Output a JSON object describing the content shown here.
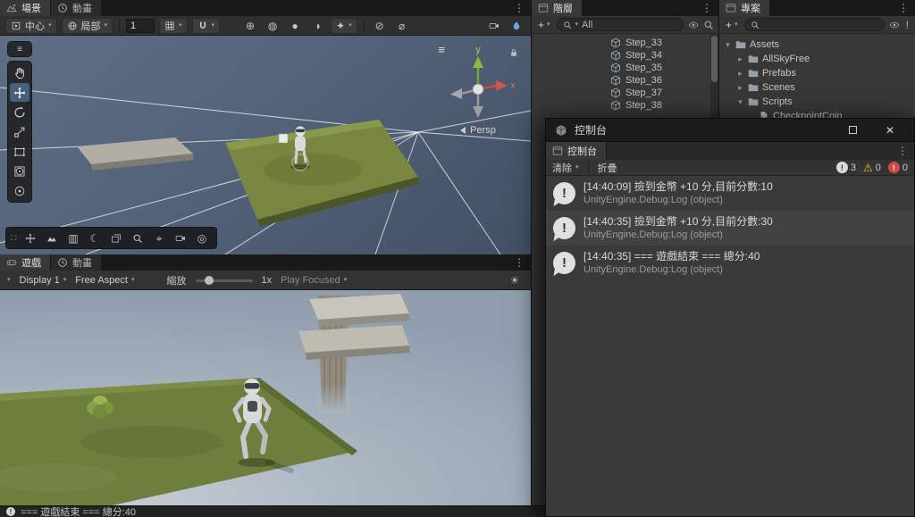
{
  "colors": {
    "accent_blue": "#46607a",
    "warning_yellow": "#f0c32e",
    "error_red": "#d04848",
    "panel_bg": "#383838"
  },
  "top_bar": {
    "tabs": [
      {
        "label": "場景"
      },
      {
        "label": "動畫"
      }
    ]
  },
  "scene_toolbar": {
    "pivot_label": "中心",
    "space_label": "局部",
    "grid_size_value": "1"
  },
  "scene_view": {
    "gizmo_axis_x": "x",
    "gizmo_axis_y": "y",
    "projection_label": "Persp"
  },
  "game_panel": {
    "tabs": [
      {
        "label": "遊戲"
      },
      {
        "label": "動畫"
      }
    ],
    "display_label": "Display 1",
    "aspect_label": "Free Aspect",
    "zoom_label": "縮放",
    "zoom_value": "1x",
    "play_focused_label": "Play Focused"
  },
  "hierarchy": {
    "tab_label": "階層",
    "search_value": "All",
    "items": [
      {
        "label": "Step_33"
      },
      {
        "label": "Step_34"
      },
      {
        "label": "Step_35"
      },
      {
        "label": "Step_36"
      },
      {
        "label": "Step_37"
      },
      {
        "label": "Step_38"
      }
    ]
  },
  "project": {
    "tab_label": "專案",
    "tree": [
      {
        "label": "Assets"
      },
      {
        "label": "AllSkyFree"
      },
      {
        "label": "Prefabs"
      },
      {
        "label": "Scenes"
      },
      {
        "label": "Scripts"
      },
      {
        "label": "CheckpointCoin"
      }
    ]
  },
  "console": {
    "window_title": "控制台",
    "tab_label": "控制台",
    "clear_label": "清除",
    "collapse_label": "折疊",
    "info_count": "3",
    "warning_count": "0",
    "error_count": "0",
    "entries": [
      {
        "message": "[14:40:09] 撿到金幣 +10 分,目前分數:10",
        "source": "UnityEngine.Debug:Log (object)"
      },
      {
        "message": "[14:40:35] 撿到金幣 +10 分,目前分數:30",
        "source": "UnityEngine.Debug:Log (object)"
      },
      {
        "message": "[14:40:35] === 遊戲結束 === 總分:40",
        "source": "UnityEngine.Debug:Log (object)"
      }
    ]
  },
  "status_bar": {
    "message": "=== 遊戲結束 === 總分:40"
  }
}
